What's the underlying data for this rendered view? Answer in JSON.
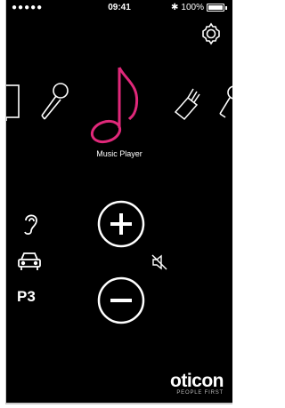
{
  "status_bar": {
    "signal": "●●●●● ",
    "time": "09:41",
    "bluetooth": "✱",
    "battery": "100%"
  },
  "programs": {
    "selected_label": "Music Player",
    "items": [
      {
        "icon": "tv-icon"
      },
      {
        "icon": "microphone-icon"
      },
      {
        "icon": "music-note-icon"
      },
      {
        "icon": "tv-adapter-icon"
      },
      {
        "icon": "phone-clip-icon"
      }
    ]
  },
  "side": {
    "program_code": "P3",
    "icons": [
      "ear-icon",
      "car-icon"
    ]
  },
  "volume": {
    "plus_icon": "plus-icon",
    "minus_icon": "minus-icon",
    "mute_icon": "speaker-mute-icon"
  },
  "brand": {
    "name": "oticon",
    "tagline": "PEOPLE FIRST"
  },
  "colors": {
    "background": "#000000",
    "accent": "#e0287a",
    "foreground": "#ffffff"
  }
}
